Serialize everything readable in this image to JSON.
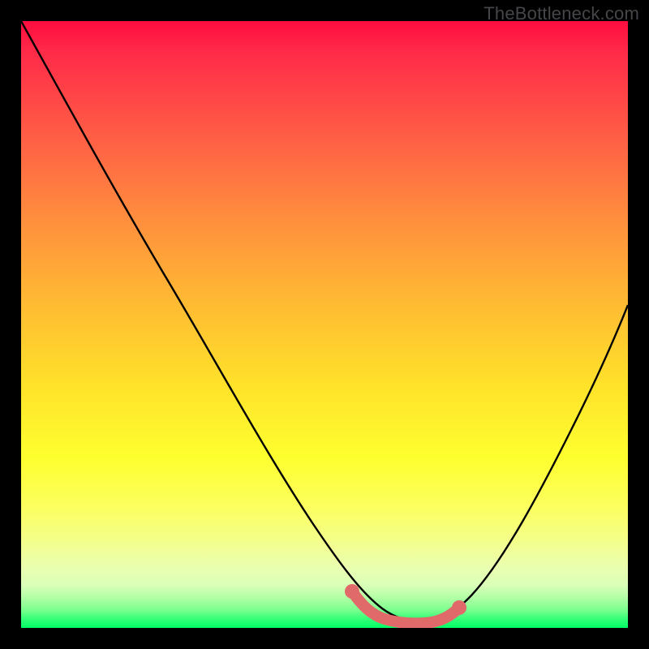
{
  "watermark": "TheBottleneck.com",
  "chart_data": {
    "type": "line",
    "title": "",
    "xlabel": "",
    "ylabel": "",
    "xlim": [
      0,
      100
    ],
    "ylim": [
      0,
      100
    ],
    "series": [
      {
        "name": "bottleneck-curve",
        "x": [
          0,
          5,
          10,
          15,
          20,
          25,
          30,
          35,
          40,
          45,
          50,
          55,
          58,
          60,
          63,
          66,
          70,
          75,
          80,
          85,
          90,
          95,
          100
        ],
        "y": [
          100,
          92,
          83,
          75,
          66,
          58,
          49,
          40,
          31,
          22,
          13,
          5,
          2,
          1,
          1,
          1,
          2,
          6,
          13,
          22,
          32,
          43,
          55
        ]
      },
      {
        "name": "highlight-segment",
        "x": [
          55,
          58,
          60,
          63,
          66,
          70
        ],
        "y": [
          5,
          2,
          1,
          1,
          1,
          2
        ]
      }
    ],
    "colors": {
      "curve": "#000000",
      "highlight": "#e06a6a",
      "gradient_top": "#ff0d3f",
      "gradient_mid": "#feff2f",
      "gradient_bottom": "#00ff66"
    }
  }
}
